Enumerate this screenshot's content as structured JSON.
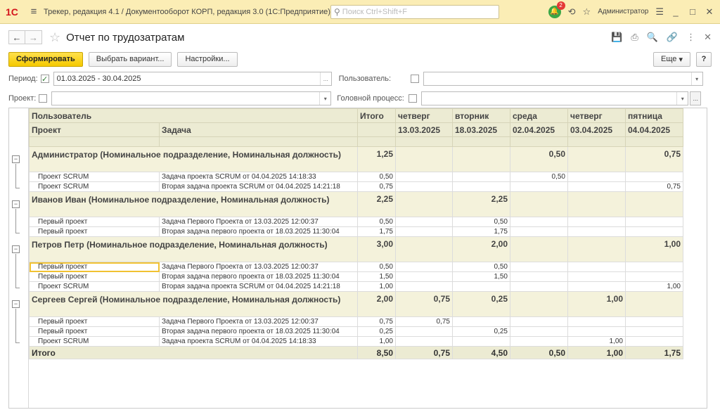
{
  "titlebar": {
    "logo": "1С",
    "app_title": "Трекер, редакция 4.1 / Документооборот КОРП, редакция 3.0  (1С:Предприятие)",
    "search_placeholder": "Поиск Ctrl+Shift+F",
    "notif_count": "2",
    "user": "Администратор"
  },
  "page": {
    "title": "Отчет по трудозатратам"
  },
  "toolbar": {
    "generate": "Сформировать",
    "choose_variant": "Выбрать вариант...",
    "settings": "Настройки...",
    "more": "Еще",
    "help": "?"
  },
  "filters": {
    "period_label": "Период:",
    "period_value": "01.03.2025 - 30.04.2025",
    "user_label": "Пользователь:",
    "project_label": "Проект:",
    "head_process_label": "Головной процесс:"
  },
  "report": {
    "header": {
      "user": "Пользователь",
      "project": "Проект",
      "task": "Задача",
      "total": "Итого",
      "days": [
        {
          "dow": "четверг",
          "date": "13.03.2025"
        },
        {
          "dow": "вторник",
          "date": "18.03.2025"
        },
        {
          "dow": "среда",
          "date": "02.04.2025"
        },
        {
          "dow": "четверг",
          "date": "03.04.2025"
        },
        {
          "dow": "пятница",
          "date": "04.04.2025"
        }
      ]
    },
    "groups": [
      {
        "name": "Администратор (Номинальное подразделение, Номинальная должность)",
        "total": "1,25",
        "days": [
          "",
          "",
          "0,50",
          "",
          "0,75"
        ],
        "rows": [
          {
            "project": "Проект SCRUM",
            "task": "Задача проекта SCRUM от 04.04.2025 14:18:33",
            "total": "0,50",
            "days": [
              "",
              "",
              "0,50",
              "",
              ""
            ]
          },
          {
            "project": "Проект SCRUM",
            "task": "Вторая задача проекта SCRUM от 04.04.2025 14:21:18",
            "total": "0,75",
            "days": [
              "",
              "",
              "",
              "",
              "0,75"
            ]
          }
        ]
      },
      {
        "name": "Иванов Иван (Номинальное подразделение, Номинальная должность)",
        "total": "2,25",
        "days": [
          "",
          "2,25",
          "",
          "",
          ""
        ],
        "rows": [
          {
            "project": "Первый проект",
            "task": "Задача Первого Проекта от 13.03.2025 12:00:37",
            "total": "0,50",
            "days": [
              "",
              "0,50",
              "",
              "",
              ""
            ]
          },
          {
            "project": "Первый проект",
            "task": "Вторая задача первого проекта от 18.03.2025 11:30:04",
            "total": "1,75",
            "days": [
              "",
              "1,75",
              "",
              "",
              ""
            ]
          }
        ]
      },
      {
        "name": "Петров Петр (Номинальное подразделение, Номинальная должность)",
        "total": "3,00",
        "days": [
          "",
          "2,00",
          "",
          "",
          "1,00"
        ],
        "rows": [
          {
            "project": "Первый проект",
            "task": "Задача Первого Проекта от 13.03.2025 12:00:37",
            "total": "0,50",
            "days": [
              "",
              "0,50",
              "",
              "",
              ""
            ]
          },
          {
            "project": "Первый проект",
            "task": "Вторая задача первого проекта от 18.03.2025 11:30:04",
            "total": "1,50",
            "days": [
              "",
              "1,50",
              "",
              "",
              ""
            ]
          },
          {
            "project": "Проект SCRUM",
            "task": "Вторая задача проекта SCRUM от 04.04.2025 14:21:18",
            "total": "1,00",
            "days": [
              "",
              "",
              "",
              "",
              "1,00"
            ]
          }
        ]
      },
      {
        "name": "Сергеев Сергей (Номинальное подразделение, Номинальная должность)",
        "total": "2,00",
        "days": [
          "0,75",
          "0,25",
          "",
          "1,00",
          ""
        ],
        "rows": [
          {
            "project": "Первый проект",
            "task": "Задача Первого Проекта от 13.03.2025 12:00:37",
            "total": "0,75",
            "days": [
              "0,75",
              "",
              "",
              "",
              ""
            ]
          },
          {
            "project": "Первый проект",
            "task": "Вторая задача первого проекта от 18.03.2025 11:30:04",
            "total": "0,25",
            "days": [
              "",
              "0,25",
              "",
              "",
              ""
            ]
          },
          {
            "project": "Проект SCRUM",
            "task": "Задача проекта SCRUM от 04.04.2025 14:18:33",
            "total": "1,00",
            "days": [
              "",
              "",
              "",
              "1,00",
              ""
            ]
          }
        ]
      }
    ],
    "grand_total": {
      "label": "Итого",
      "total": "8,50",
      "days": [
        "0,75",
        "4,50",
        "0,50",
        "1,00",
        "1,75"
      ]
    }
  }
}
